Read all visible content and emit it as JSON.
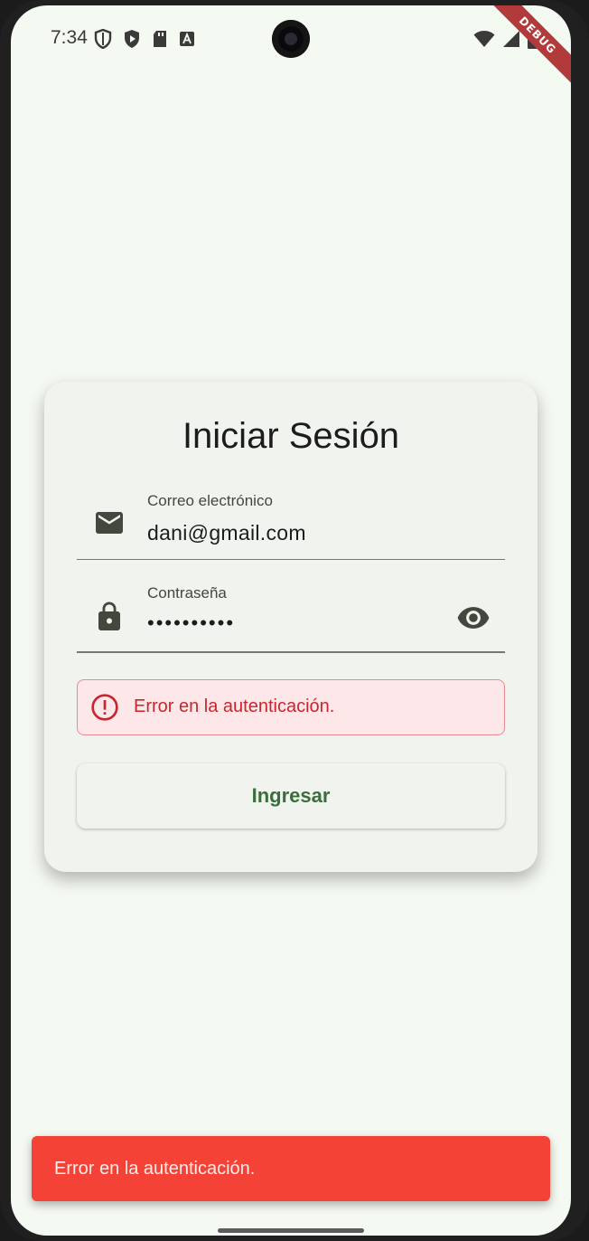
{
  "status_bar": {
    "time": "7:34",
    "left_icons": [
      "shield-outline-icon",
      "shield-play-icon",
      "sd-card-icon",
      "text-a-icon"
    ],
    "right_icons": [
      "wifi-icon",
      "signal-icon",
      "battery-icon"
    ]
  },
  "debug_banner": "DEBUG",
  "login": {
    "title": "Iniciar Sesión",
    "email": {
      "label": "Correo electrónico",
      "value": "dani@gmail.com",
      "icon": "mail-icon"
    },
    "password": {
      "label": "Contraseña",
      "value": "••••••••••",
      "icon": "lock-icon",
      "toggle_icon": "eye-icon"
    },
    "error": {
      "icon": "error-circle-icon",
      "text": "Error en la autenticación."
    },
    "submit_label": "Ingresar"
  },
  "snackbar": {
    "text": "Error en la autenticación."
  },
  "colors": {
    "background": "#f4f9f1",
    "card": "#f1f4ee",
    "error_text": "#c8262e",
    "error_bg": "#fde7e8",
    "button_text": "#3a6e3a",
    "snackbar": "#f44336"
  }
}
